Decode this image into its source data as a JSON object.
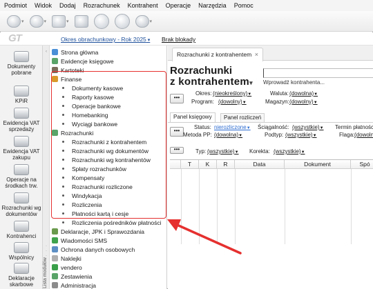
{
  "menu": [
    "Podmiot",
    "Widok",
    "Dodaj",
    "Rozrachunek",
    "Kontrahent",
    "Operacje",
    "Narzędzia",
    "Pomoc"
  ],
  "subbar": {
    "logo": "GT",
    "period_label": "Okres obrachunkowy - Rok 2025",
    "blokady_label": "Brak blokady"
  },
  "leftnav": [
    {
      "label": "Dokumenty pobrane",
      "icon": "documents-download-icon"
    },
    {
      "label": "KPiR",
      "icon": "kpir-book-icon"
    },
    {
      "label": "Ewidencja VAT sprzedaży",
      "icon": "vat-sales-icon"
    },
    {
      "label": "Ewidencja VAT zakupu",
      "icon": "vat-purchase-icon"
    },
    {
      "label": "Operacje na środkach trw.",
      "icon": "fixed-assets-icon"
    },
    {
      "label": "Rozrachunki wg dokumentów",
      "icon": "settlements-icon"
    },
    {
      "label": "Kontrahenci",
      "icon": "contractors-icon"
    },
    {
      "label": "Wspólnicy",
      "icon": "partners-icon"
    },
    {
      "label": "Deklaracje skarbowe",
      "icon": "tax-declarations-icon"
    }
  ],
  "splitter_label": "Lista modułów",
  "tree": [
    {
      "label": "Strona główna",
      "type": "top",
      "color": "#4a8fd6"
    },
    {
      "label": "Ewidencje księgowe",
      "type": "top",
      "color": "#5aa469"
    },
    {
      "label": "Kartoteki",
      "type": "top",
      "color": "#7b6d5c"
    },
    {
      "label": "Finanse",
      "type": "group",
      "color": "#d99a2b"
    },
    {
      "label": "Dokumenty kasowe",
      "type": "child"
    },
    {
      "label": "Raporty kasowe",
      "type": "child"
    },
    {
      "label": "Operacje bankowe",
      "type": "child"
    },
    {
      "label": "Homebanking",
      "type": "child"
    },
    {
      "label": "Wyciągi bankowe",
      "type": "child"
    },
    {
      "label": "Rozrachunki",
      "type": "group",
      "color": "#5aa469"
    },
    {
      "label": "Rozrachunki z kontrahentem",
      "type": "child"
    },
    {
      "label": "Rozrachunki wg dokumentów",
      "type": "child"
    },
    {
      "label": "Rozrachunki wg kontrahentów",
      "type": "child"
    },
    {
      "label": "Spłaty rozrachunków",
      "type": "child"
    },
    {
      "label": "Kompensaty",
      "type": "child"
    },
    {
      "label": "Rozrachunki rozliczone",
      "type": "child"
    },
    {
      "label": "Windykacja",
      "type": "child"
    },
    {
      "label": "Rozliczenia",
      "type": "child"
    },
    {
      "label": "Płatności kartą i cesje",
      "type": "child"
    },
    {
      "label": "Rozliczenia pośredników płatności",
      "type": "child"
    },
    {
      "label": "Deklaracje, JPK i Sprawozdania",
      "type": "top",
      "color": "#6a9a4d"
    },
    {
      "label": "Wiadomości SMS",
      "type": "top",
      "color": "#3fa34d"
    },
    {
      "label": "Ochrona danych osobowych",
      "type": "top",
      "color": "#5d8fc4"
    },
    {
      "label": "Naklejki",
      "type": "top",
      "color": "#b0b0b0"
    },
    {
      "label": "vendero",
      "type": "top",
      "color": "#3aa04a"
    },
    {
      "label": "Zestawienia",
      "type": "top",
      "color": "#5aa469"
    },
    {
      "label": "Administracja",
      "type": "top",
      "color": "#8c8c8c"
    }
  ],
  "content": {
    "tab_label": "Rozrachunki z kontrahentem",
    "tab_close": "×",
    "title_line1": "Rozrachunki",
    "title_line2": "z kontrahentem",
    "kontrahent_hint": "Wprowadź kontrahenta...",
    "dots": "•••",
    "filters": {
      "okres_label": "Okres:",
      "okres_value": "(nieokreślony)",
      "waluta_label": "Waluta:",
      "waluta_value": "(dowolna)",
      "program_label": "Program:",
      "program_value": "(dowolny)",
      "magazyn_label": "Magazyn:",
      "magazyn_value": "(dowolny)"
    },
    "panel_tabs": [
      "Panel księgowy",
      "Panel rozliczeń"
    ],
    "panel_filters": {
      "status_label": "Status:",
      "status_value": "nierozliczone",
      "sciagalnosc_label": "Ściągalność:",
      "sciagalnosc_value": "(wszystkie)",
      "termin_label": "Termin płatności",
      "metoda_label": "Metoda PP:",
      "metoda_value": "(dowolna)",
      "podtyp_label": "Podtyp:",
      "podtyp_value": "(wszystkie)",
      "flaga_label": "Flaga:",
      "flaga_value": "(dowolna)",
      "typ_label": "Typ:",
      "typ_value": "(wszystkie)",
      "korekta_label": "Korekta:",
      "korekta_value": "(wszystkie)"
    },
    "grid_columns": [
      "",
      "T",
      "K",
      "R",
      "Data",
      "Dokument",
      "Spó"
    ]
  },
  "colors": {
    "highlight": "#e5302f",
    "link_blue": "#2b6bd0",
    "period_blue": "#1d4f9a"
  }
}
